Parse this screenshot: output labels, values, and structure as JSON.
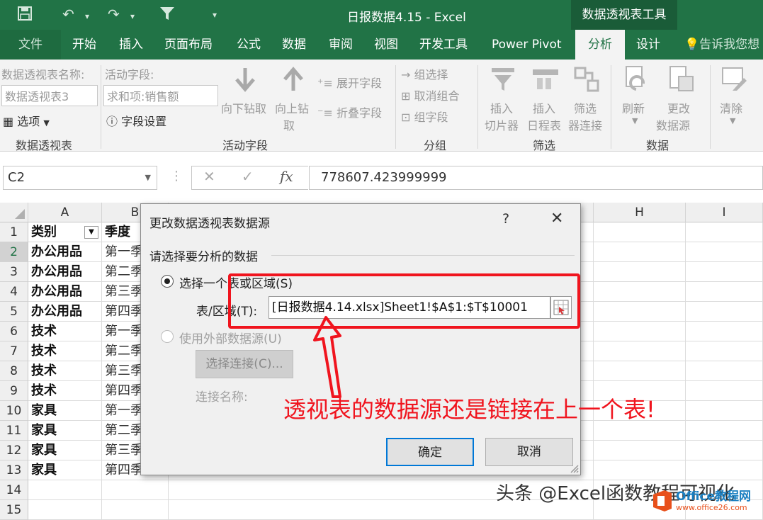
{
  "window": {
    "title": "日报数据4.15 - Excel",
    "contextual_tab_group": "数据透视表工具"
  },
  "tabs": [
    {
      "label": "文件"
    },
    {
      "label": "开始"
    },
    {
      "label": "插入"
    },
    {
      "label": "页面布局"
    },
    {
      "label": "公式"
    },
    {
      "label": "数据"
    },
    {
      "label": "审阅"
    },
    {
      "label": "视图"
    },
    {
      "label": "开发工具"
    },
    {
      "label": "Power Pivot"
    },
    {
      "label": "分析"
    },
    {
      "label": "设计"
    },
    {
      "label": "告诉我您想"
    }
  ],
  "ribbon": {
    "pivot_name_label": "数据透视表名称:",
    "pivot_name_value": "数据透视表3",
    "options_label": "选项",
    "group_pivot": "数据透视表",
    "active_field_label": "活动字段:",
    "active_field_value": "求和项:销售额",
    "field_settings": "字段设置",
    "drill_down": "向下钻取",
    "drill_up_1": "向上钻",
    "drill_up_2": "取",
    "expand_field": "展开字段",
    "collapse_field": "折叠字段",
    "group_active_field": "活动字段",
    "group_selection": "组选择",
    "ungroup": "取消组合",
    "group_field": "组字段",
    "group_group": "分组",
    "insert_slicer_1": "插入",
    "insert_slicer_2": "切片器",
    "insert_timeline_1": "插入",
    "insert_timeline_2": "日程表",
    "filter_conn_1": "筛选",
    "filter_conn_2": "器连接",
    "group_filter": "筛选",
    "refresh": "刷新",
    "change_source_1": "更改",
    "change_source_2": "数据源",
    "group_data": "数据",
    "clear": "清除"
  },
  "formula_bar": {
    "name_box": "C2",
    "fx": "fx",
    "formula": "778607.423999999"
  },
  "sheet": {
    "columns": [
      "A",
      "B",
      "H",
      "I"
    ],
    "rows": [
      "1",
      "2",
      "3",
      "4",
      "5",
      "6",
      "7",
      "8",
      "9",
      "10",
      "11",
      "12",
      "13",
      "14",
      "15"
    ],
    "header_a": "类别",
    "header_b": "季度",
    "col_a": [
      "办公用品",
      "办公用品",
      "办公用品",
      "办公用品",
      "技术",
      "技术",
      "技术",
      "技术",
      "家具",
      "家具",
      "家具",
      "家具"
    ],
    "col_b": [
      "第一季",
      "第二季",
      "第三季",
      "第四季",
      "第一季",
      "第二季",
      "第三季",
      "第四季",
      "第一季",
      "第二季",
      "第三季",
      "第四季"
    ]
  },
  "dialog": {
    "title": "更改数据透视表数据源",
    "help": "?",
    "close": "✕",
    "section_label": "请选择要分析的数据",
    "radio_table": "选择一个表或区域(S)",
    "range_label": "表/区域(T):",
    "range_value": "[日报数据4.14.xlsx]Sheet1!$A$1:$T$10001",
    "radio_external": "使用外部数据源(U)",
    "choose_connection": "选择连接(C)...",
    "connection_name_label": "连接名称:",
    "ok": "确定",
    "cancel": "取消"
  },
  "annotation": {
    "text": "透视表的数据源还是链接在上一个表!",
    "color": "#f0141e"
  },
  "watermark": {
    "text": "头条 @Excel函数教程可视化",
    "logo_text": "Office教程网",
    "logo_url": "www.office26.com"
  },
  "colors": {
    "excel_green": "#217346",
    "highlight_red": "#f0141e"
  }
}
